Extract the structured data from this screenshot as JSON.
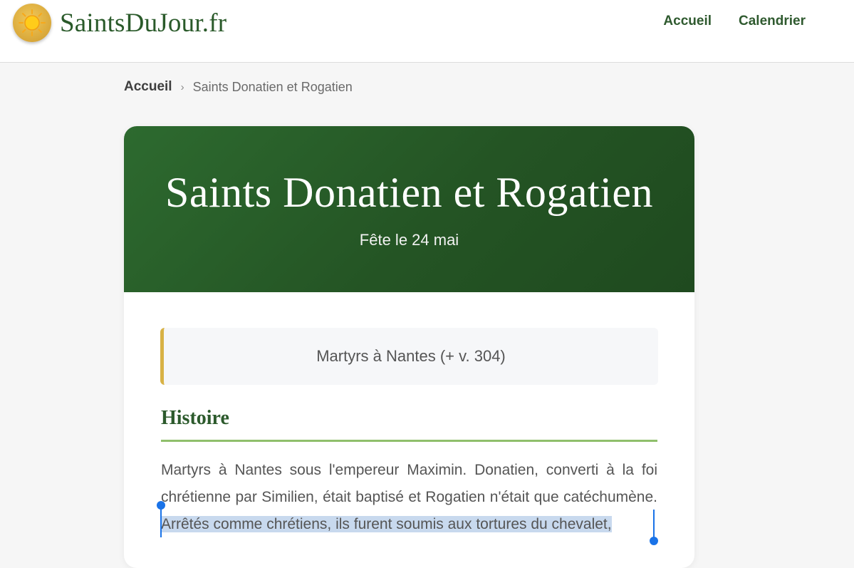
{
  "header": {
    "brand": "SaintsDuJour.fr",
    "logo_icon": "sun-icon",
    "nav": [
      {
        "label": "Accueil"
      },
      {
        "label": "Calendrier"
      }
    ]
  },
  "breadcrumb": {
    "home": "Accueil",
    "separator": "›",
    "current": "Saints Donatien et Rogatien"
  },
  "hero": {
    "title": "Saints Donatien et Rogatien",
    "feast": "Fête le 24 mai"
  },
  "summary": "Martyrs à Nantes (+ v. 304)",
  "section": {
    "title": "Histoire",
    "text_plain": "Martyrs à Nantes sous l'empereur Maximin. Donatien, converti à la foi chrétienne par Similien, était baptisé et Rogatien n'était que catéchumène.",
    "text_selected": "Arrêtés comme chrétiens, ils furent soumis aux tortures du chevalet,"
  },
  "colors": {
    "brand_green": "#2a5a2a",
    "hero_green": "#245424",
    "accent_gold": "#d8b245",
    "rule_green": "#8fbf6b",
    "selection": "#c8d9ee",
    "selection_handle": "#1a73e8"
  }
}
